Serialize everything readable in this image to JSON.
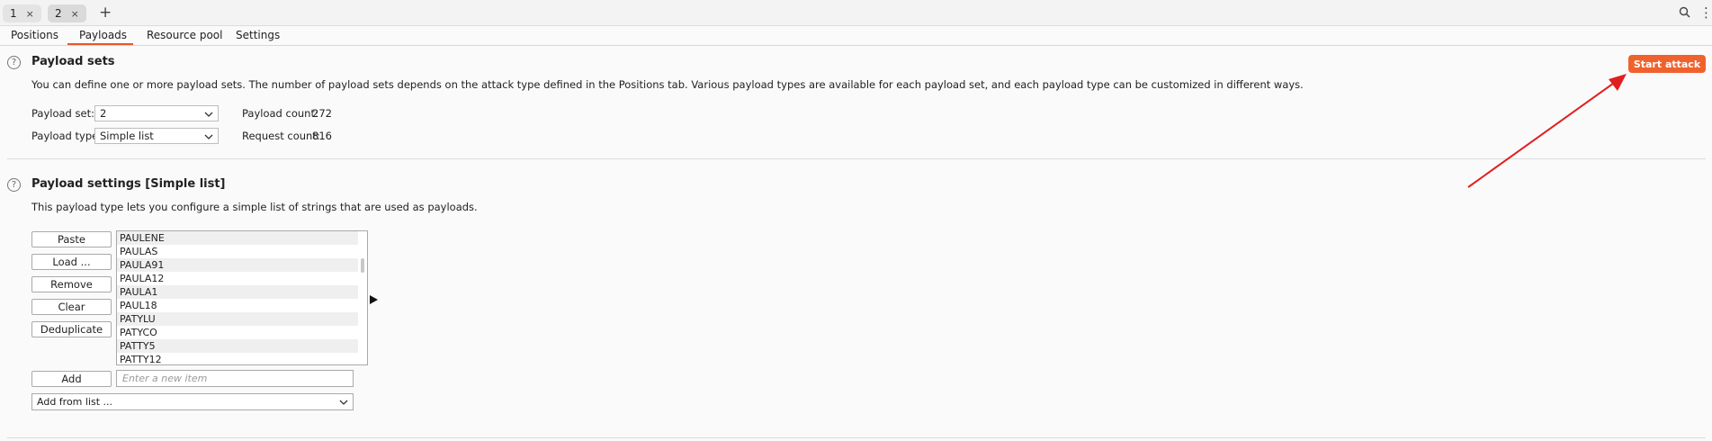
{
  "request_tabs": [
    {
      "num": "1",
      "close": "×"
    },
    {
      "num": "2",
      "close": "×"
    }
  ],
  "new_tab": "+",
  "subtabs": [
    "Positions",
    "Payloads",
    "Resource pool",
    "Settings"
  ],
  "active_subtab": "Payloads",
  "payload_sets": {
    "help": "?",
    "title": "Payload sets",
    "description": "You can define one or more payload sets. The number of payload sets depends on the attack type defined in the Positions tab. Various payload types are available for each payload set, and each payload type can be customized in different ways.",
    "set_label": "Payload set:",
    "set_value": "2",
    "type_label": "Payload type:",
    "type_value": "Simple list",
    "count_label": "Payload count:",
    "count_value": "272",
    "request_label": "Request count:",
    "request_value": "816"
  },
  "start_attack": "Start attack",
  "payload_settings": {
    "help": "?",
    "title": "Payload settings [Simple list]",
    "description": "This payload type lets you configure a simple list of strings that are used as payloads.",
    "buttons": {
      "paste": "Paste",
      "load": "Load ...",
      "remove": "Remove",
      "clear": "Clear",
      "deduplicate": "Deduplicate",
      "add": "Add"
    },
    "items": [
      "PAULENE",
      "PAULAS",
      "PAULA91",
      "PAULA12",
      "PAULA1",
      "PAUL18",
      "PATYLU",
      "PATYCO",
      "PATTY5",
      "PATTY12"
    ],
    "new_item_placeholder": "Enter a new item",
    "add_from_list": "Add from list ..."
  },
  "colors": {
    "accent": "#f0622d",
    "annotation_arrow": "#e02020"
  },
  "icons": [
    "search-icon",
    "more-vertical-icon",
    "help-icon",
    "chevron-down-icon",
    "play-arrow-icon"
  ]
}
